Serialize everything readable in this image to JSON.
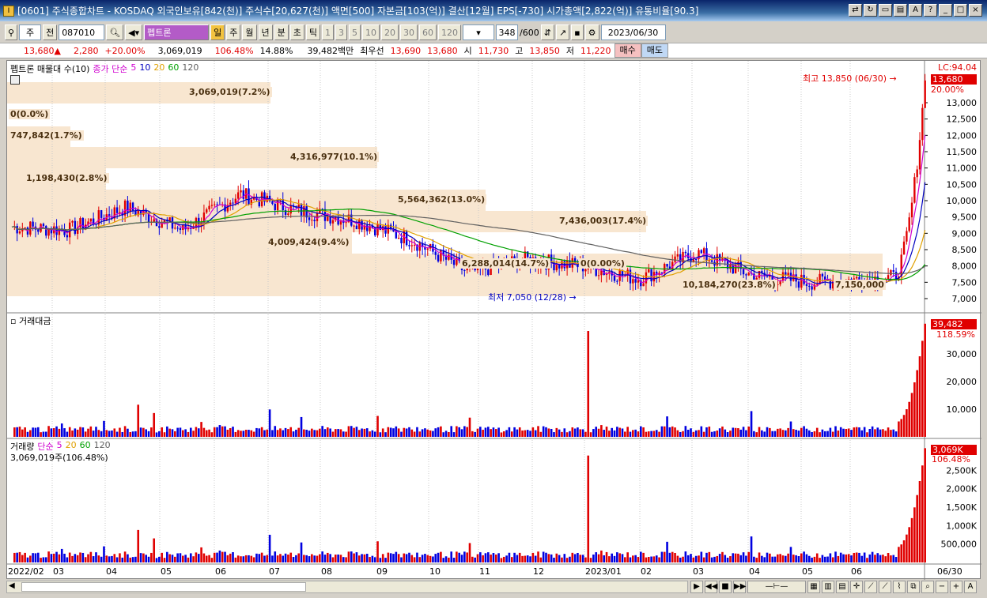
{
  "window": {
    "title": "[0601] 주식종합차트 - KOSDAQ 외국인보유[842(천)] 주식수[20,627(천)] 액면[500] 자본금[103(억)] 결산[12월] EPS[-730] 시가총액[2,822(억)] 유통비율[90.3]",
    "app_icon": "I"
  },
  "toolbar": {
    "type_select": "주",
    "prev_label": "전",
    "code": "087010",
    "stock_name": "펩트론",
    "periods": [
      "일",
      "주",
      "월",
      "년",
      "분",
      "초",
      "틱"
    ],
    "intervals": [
      "1",
      "3",
      "5",
      "10",
      "20",
      "30",
      "60",
      "120"
    ],
    "count": "348",
    "count_total": "/600",
    "date": "2023/06/30"
  },
  "quote": {
    "price": "13,680▲",
    "change": "2,280",
    "change_pct": "+20.00%",
    "volume": "3,069,019",
    "vol_ratio": "106.48%",
    "turnover": "14.88%",
    "amount": "39,482백만",
    "best_ask_label": "최우선",
    "best_ask": "13,690",
    "best_bid": "13,680",
    "open_label": "시",
    "open": "11,730",
    "high_label": "고",
    "high": "13,850",
    "low_label": "저",
    "low": "11,220",
    "buy_label": "매수",
    "sell_label": "매도"
  },
  "price_panel": {
    "legend_title": "펩트론 매물대 수(10)",
    "ma_label": "종가 단순",
    "ma_periods": [
      "5",
      "10",
      "20",
      "60",
      "120"
    ],
    "lc_label": "LC:94.04",
    "current_tag": "13,680",
    "pct_tag": "20.00%",
    "high_annot": "최고 13,850 (06/30) →",
    "low_annot": "최저 7,050 (12/28) →",
    "y_ticks": [
      "13,000",
      "12,500",
      "12,000",
      "11,500",
      "11,000",
      "10,500",
      "10,000",
      "9,500",
      "9,000",
      "8,500",
      "8,000",
      "7,500",
      "7,000"
    ],
    "bands": [
      "3,069,019(7.2%)",
      "0(0.0%)",
      "747,842(1.7%)",
      "4,316,977(10.1%)",
      "1,198,430(2.8%)",
      "5,564,362(13.0%)",
      "7,436,003(17.4%)",
      "4,009,424(9.4%)",
      "6,288,014(14.7%)",
      "0(0.00%)",
      "10,184,270(23.8%)",
      "7,150,000"
    ]
  },
  "amount_panel": {
    "title": "거래대금",
    "tag": "39,482",
    "pct": "118.59%",
    "y_ticks": [
      "30,000",
      "20,000",
      "10,000"
    ]
  },
  "volume_panel": {
    "title": "거래량",
    "ma_label": "단순",
    "ma_periods": [
      "5",
      "20",
      "60",
      "120"
    ],
    "value_text": "3,069,019주(106.48%)",
    "tag": "3,069K",
    "pct": "106.48%",
    "y_ticks": [
      "2,500K",
      "2,000K",
      "1,500K",
      "1,000K",
      "500,000"
    ]
  },
  "x_axis": [
    "2022/02",
    "03",
    "04",
    "05",
    "06",
    "07",
    "08",
    "09",
    "10",
    "11",
    "12",
    "2023/01",
    "02",
    "03",
    "04",
    "05",
    "06",
    "06/30"
  ],
  "colors": {
    "up": "#e00000",
    "down": "#0000e0",
    "ma5": "#d000d0",
    "ma10": "#0000c0",
    "ma20": "#e0a000",
    "ma60": "#00a000",
    "ma120": "#606060",
    "band": "#f8e6d0"
  },
  "chart_data": {
    "type": "candlestick",
    "title": "펩트론",
    "x": [
      "2022/02",
      "03",
      "04",
      "05",
      "06",
      "07",
      "08",
      "09",
      "10",
      "11",
      "12",
      "2023/01",
      "02",
      "03",
      "04",
      "05",
      "06",
      "06/30"
    ],
    "close_approx": [
      9200,
      9100,
      9800,
      9100,
      10200,
      9700,
      9400,
      8800,
      7800,
      8200,
      8000,
      7600,
      8400,
      7700,
      7500,
      7600,
      7700,
      13680
    ],
    "ylim": [
      7000,
      14000
    ]
  }
}
